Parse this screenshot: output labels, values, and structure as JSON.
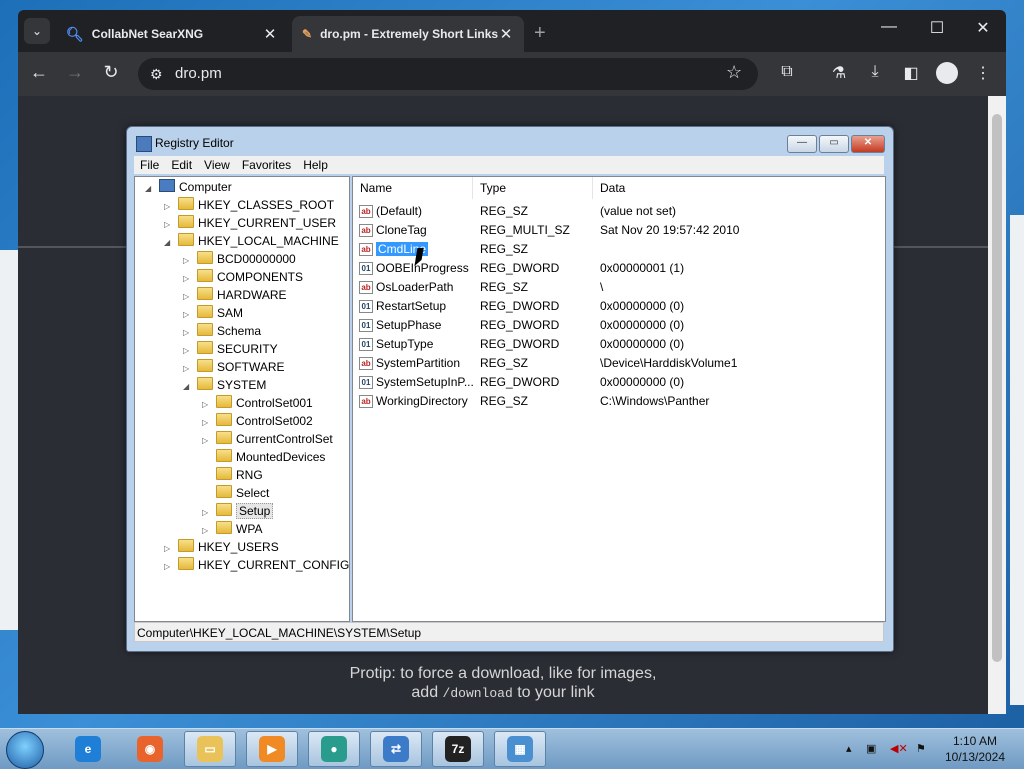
{
  "browser": {
    "tabs": [
      {
        "title": "CollabNet SearXNG",
        "active": false
      },
      {
        "title": "dro.pm - Extremely Short Links",
        "active": true
      }
    ],
    "url": "dro.pm",
    "protip_line1": "Protip: to force a download, like for images,",
    "protip_line2_a": "add",
    "protip_code": "/download",
    "protip_line2_b": "to your link"
  },
  "regedit": {
    "title": "Registry Editor",
    "menu": [
      "File",
      "Edit",
      "View",
      "Favorites",
      "Help"
    ],
    "tree": [
      {
        "label": "Computer",
        "depth": 0,
        "expanded": true,
        "type": "computer"
      },
      {
        "label": "HKEY_CLASSES_ROOT",
        "depth": 1,
        "expanded": false
      },
      {
        "label": "HKEY_CURRENT_USER",
        "depth": 1,
        "expanded": false
      },
      {
        "label": "HKEY_LOCAL_MACHINE",
        "depth": 1,
        "expanded": true
      },
      {
        "label": "BCD00000000",
        "depth": 2,
        "expanded": false
      },
      {
        "label": "COMPONENTS",
        "depth": 2,
        "expanded": false
      },
      {
        "label": "HARDWARE",
        "depth": 2,
        "expanded": false
      },
      {
        "label": "SAM",
        "depth": 2,
        "expanded": false
      },
      {
        "label": "Schema",
        "depth": 2,
        "expanded": false
      },
      {
        "label": "SECURITY",
        "depth": 2,
        "expanded": false
      },
      {
        "label": "SOFTWARE",
        "depth": 2,
        "expanded": false
      },
      {
        "label": "SYSTEM",
        "depth": 2,
        "expanded": true
      },
      {
        "label": "ControlSet001",
        "depth": 3,
        "expanded": false
      },
      {
        "label": "ControlSet002",
        "depth": 3,
        "expanded": false
      },
      {
        "label": "CurrentControlSet",
        "depth": 3,
        "expanded": false
      },
      {
        "label": "MountedDevices",
        "depth": 3,
        "leaf": true
      },
      {
        "label": "RNG",
        "depth": 3,
        "leaf": true
      },
      {
        "label": "Select",
        "depth": 3,
        "leaf": true
      },
      {
        "label": "Setup",
        "depth": 3,
        "expanded": false,
        "selected": true
      },
      {
        "label": "WPA",
        "depth": 3,
        "expanded": false
      },
      {
        "label": "HKEY_USERS",
        "depth": 1,
        "expanded": false
      },
      {
        "label": "HKEY_CURRENT_CONFIG",
        "depth": 1,
        "expanded": false
      }
    ],
    "columns": {
      "name": "Name",
      "type": "Type",
      "data": "Data"
    },
    "values": [
      {
        "name": "(Default)",
        "type": "REG_SZ",
        "data": "(value not set)",
        "icon": "ab"
      },
      {
        "name": "CloneTag",
        "type": "REG_MULTI_SZ",
        "data": "Sat Nov 20 19:57:42 2010",
        "icon": "ab"
      },
      {
        "name": "CmdLine",
        "type": "REG_SZ",
        "data": "",
        "icon": "ab",
        "selected": true
      },
      {
        "name": "OOBEInProgress",
        "type": "REG_DWORD",
        "data": "0x00000001 (1)",
        "icon": "bin"
      },
      {
        "name": "OsLoaderPath",
        "type": "REG_SZ",
        "data": "\\",
        "icon": "ab"
      },
      {
        "name": "RestartSetup",
        "type": "REG_DWORD",
        "data": "0x00000000 (0)",
        "icon": "bin"
      },
      {
        "name": "SetupPhase",
        "type": "REG_DWORD",
        "data": "0x00000000 (0)",
        "icon": "bin"
      },
      {
        "name": "SetupType",
        "type": "REG_DWORD",
        "data": "0x00000000 (0)",
        "icon": "bin"
      },
      {
        "name": "SystemPartition",
        "type": "REG_SZ",
        "data": "\\Device\\HarddiskVolume1",
        "icon": "ab"
      },
      {
        "name": "SystemSetupInP...",
        "type": "REG_DWORD",
        "data": "0x00000000 (0)",
        "icon": "bin"
      },
      {
        "name": "WorkingDirectory",
        "type": "REG_SZ",
        "data": "C:\\Windows\\Panther",
        "icon": "ab"
      }
    ],
    "status": "Computer\\HKEY_LOCAL_MACHINE\\SYSTEM\\Setup"
  },
  "taskbar": {
    "apps": [
      {
        "name": "internet-explorer-icon",
        "color": "#1f7fd6",
        "glyph": "e"
      },
      {
        "name": "firefox-icon",
        "color": "#e8642c",
        "glyph": "◉"
      },
      {
        "name": "file-explorer-icon",
        "color": "#e9c35a",
        "glyph": "▭"
      },
      {
        "name": "media-player-icon",
        "color": "#f08a24",
        "glyph": "▶"
      },
      {
        "name": "browser-app-icon",
        "color": "#2a9c8e",
        "glyph": "●"
      },
      {
        "name": "network-app-icon",
        "color": "#3b7bc8",
        "glyph": "⇄"
      },
      {
        "name": "7zip-icon",
        "color": "#222222",
        "glyph": "7z"
      },
      {
        "name": "registry-editor-icon",
        "color": "#4a8fd0",
        "glyph": "▦"
      }
    ],
    "time": "1:10 AM",
    "date": "10/13/2024"
  }
}
